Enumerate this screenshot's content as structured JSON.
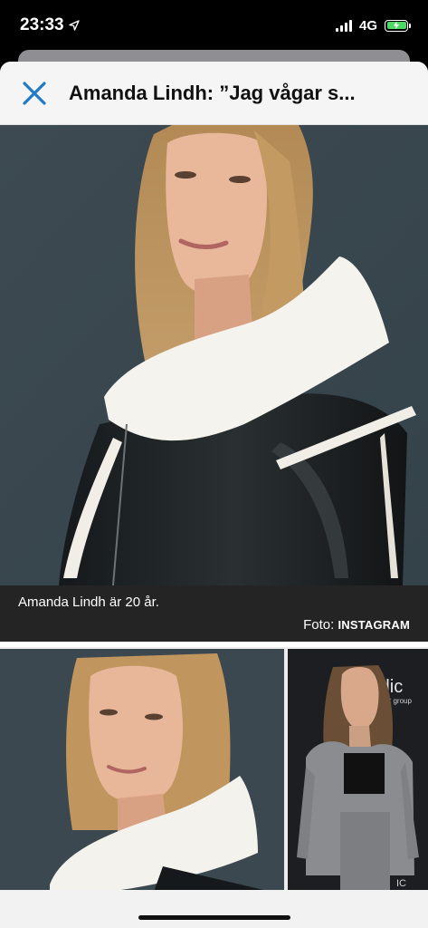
{
  "status_bar": {
    "time": "23:33",
    "network": "4G",
    "location_icon": "location-arrow-icon",
    "battery_color": "#4cd964"
  },
  "nav": {
    "close_icon": "close-icon",
    "title": "Amanda Lindh: ”Jag vågar s...",
    "accent_color": "#1f7ac7"
  },
  "gallery": {
    "main_caption": "Amanda Lindh är 20 år.",
    "credit_prefix": "Foto: ",
    "credit_source": "INSTAGRAM"
  },
  "thumbnails": {
    "backdrop_text_1": "rdic",
    "backdrop_text_2": "ement group",
    "backdrop_text_3": "IC"
  }
}
